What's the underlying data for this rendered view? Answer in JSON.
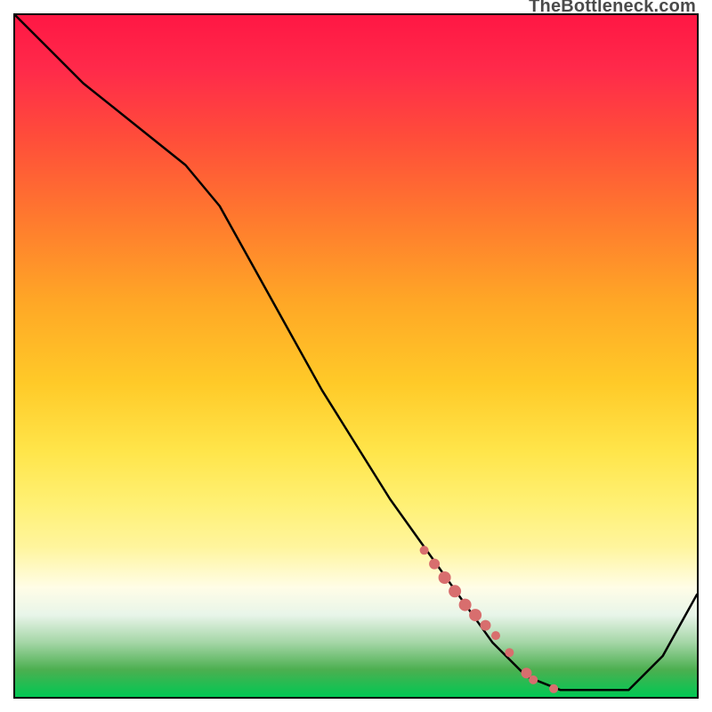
{
  "watermark": "TheBottleneck.com",
  "chart_data": {
    "type": "line",
    "title": "",
    "xlabel": "",
    "ylabel": "",
    "x_range": [
      0,
      1
    ],
    "y_range": [
      0,
      1
    ],
    "line": {
      "x": [
        0.0,
        0.05,
        0.1,
        0.15,
        0.2,
        0.25,
        0.3,
        0.35,
        0.4,
        0.45,
        0.5,
        0.55,
        0.6,
        0.65,
        0.7,
        0.75,
        0.8,
        0.85,
        0.9,
        0.95,
        1.0
      ],
      "y": [
        1.0,
        0.95,
        0.9,
        0.86,
        0.82,
        0.78,
        0.72,
        0.63,
        0.54,
        0.45,
        0.37,
        0.29,
        0.22,
        0.15,
        0.08,
        0.03,
        0.01,
        0.01,
        0.01,
        0.06,
        0.15
      ]
    },
    "markers": [
      {
        "x": 0.6,
        "y": 0.215,
        "r": 5
      },
      {
        "x": 0.615,
        "y": 0.195,
        "r": 6
      },
      {
        "x": 0.63,
        "y": 0.175,
        "r": 7
      },
      {
        "x": 0.645,
        "y": 0.155,
        "r": 7
      },
      {
        "x": 0.66,
        "y": 0.135,
        "r": 7
      },
      {
        "x": 0.675,
        "y": 0.12,
        "r": 7
      },
      {
        "x": 0.69,
        "y": 0.105,
        "r": 6
      },
      {
        "x": 0.705,
        "y": 0.09,
        "r": 5
      },
      {
        "x": 0.725,
        "y": 0.065,
        "r": 5
      },
      {
        "x": 0.75,
        "y": 0.035,
        "r": 6
      },
      {
        "x": 0.76,
        "y": 0.025,
        "r": 5
      },
      {
        "x": 0.79,
        "y": 0.012,
        "r": 5
      }
    ],
    "marker_color": "#d86e6e",
    "line_color": "#000000",
    "line_width": 2.5,
    "gradient_stops": [
      {
        "pos": 0.0,
        "color": "#ff1744"
      },
      {
        "pos": 0.5,
        "color": "#ffca28"
      },
      {
        "pos": 0.8,
        "color": "#fffde7"
      },
      {
        "pos": 1.0,
        "color": "#00c853"
      }
    ]
  }
}
